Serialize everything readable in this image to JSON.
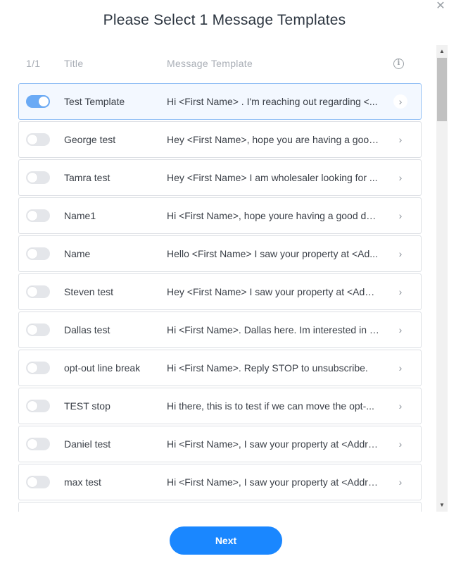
{
  "modal": {
    "title": "Please Select 1 Message Templates",
    "close_glyph": "✕",
    "next_label": "Next"
  },
  "table": {
    "headers": {
      "count": "1/1",
      "title": "Title",
      "message": "Message Template",
      "info_glyph": "i"
    },
    "rows": [
      {
        "title": "Test Template",
        "message": "Hi <First Name> . I'm reaching out regarding <...",
        "selected": true
      },
      {
        "title": "George test",
        "message": "Hey <First Name>, hope you are having a good ...",
        "selected": false
      },
      {
        "title": "Tamra test",
        "message": "Hey <First Name> I am wholesaler looking for ...",
        "selected": false
      },
      {
        "title": "Name1",
        "message": "Hi <First Name>, hope youre having a good day...",
        "selected": false
      },
      {
        "title": "Name",
        "message": "Hello <First Name> I saw your property at <Ad...",
        "selected": false
      },
      {
        "title": "Steven test",
        "message": "Hey <First Name> I saw your property at <Addr...",
        "selected": false
      },
      {
        "title": "Dallas test",
        "message": "Hi <First Name>. Dallas here. Im interested in y...",
        "selected": false
      },
      {
        "title": "opt-out line break",
        "message": "Hi <First Name>. Reply STOP to unsubscribe.",
        "selected": false
      },
      {
        "title": "TEST stop",
        "message": "Hi there, this is to test if we can move the opt-...",
        "selected": false
      },
      {
        "title": "Daniel test",
        "message": "Hi <First Name>, I saw your property at <Addre...",
        "selected": false
      },
      {
        "title": "max test",
        "message": "Hi <First Name>, I saw your property at <Addre...",
        "selected": false
      },
      {
        "title": "",
        "message": "",
        "selected": false
      }
    ]
  },
  "icons": {
    "close": "close-icon",
    "info": "info-icon",
    "chevron": "chevron-right-icon",
    "scroll_up": "scroll-up-icon",
    "scroll_down": "scroll-down-icon"
  },
  "colors": {
    "accent": "#1a87ff",
    "toggle_on": "#6aaaf5",
    "selected_row_bg": "#f3f8ff",
    "selected_row_border": "#93c0f5"
  }
}
